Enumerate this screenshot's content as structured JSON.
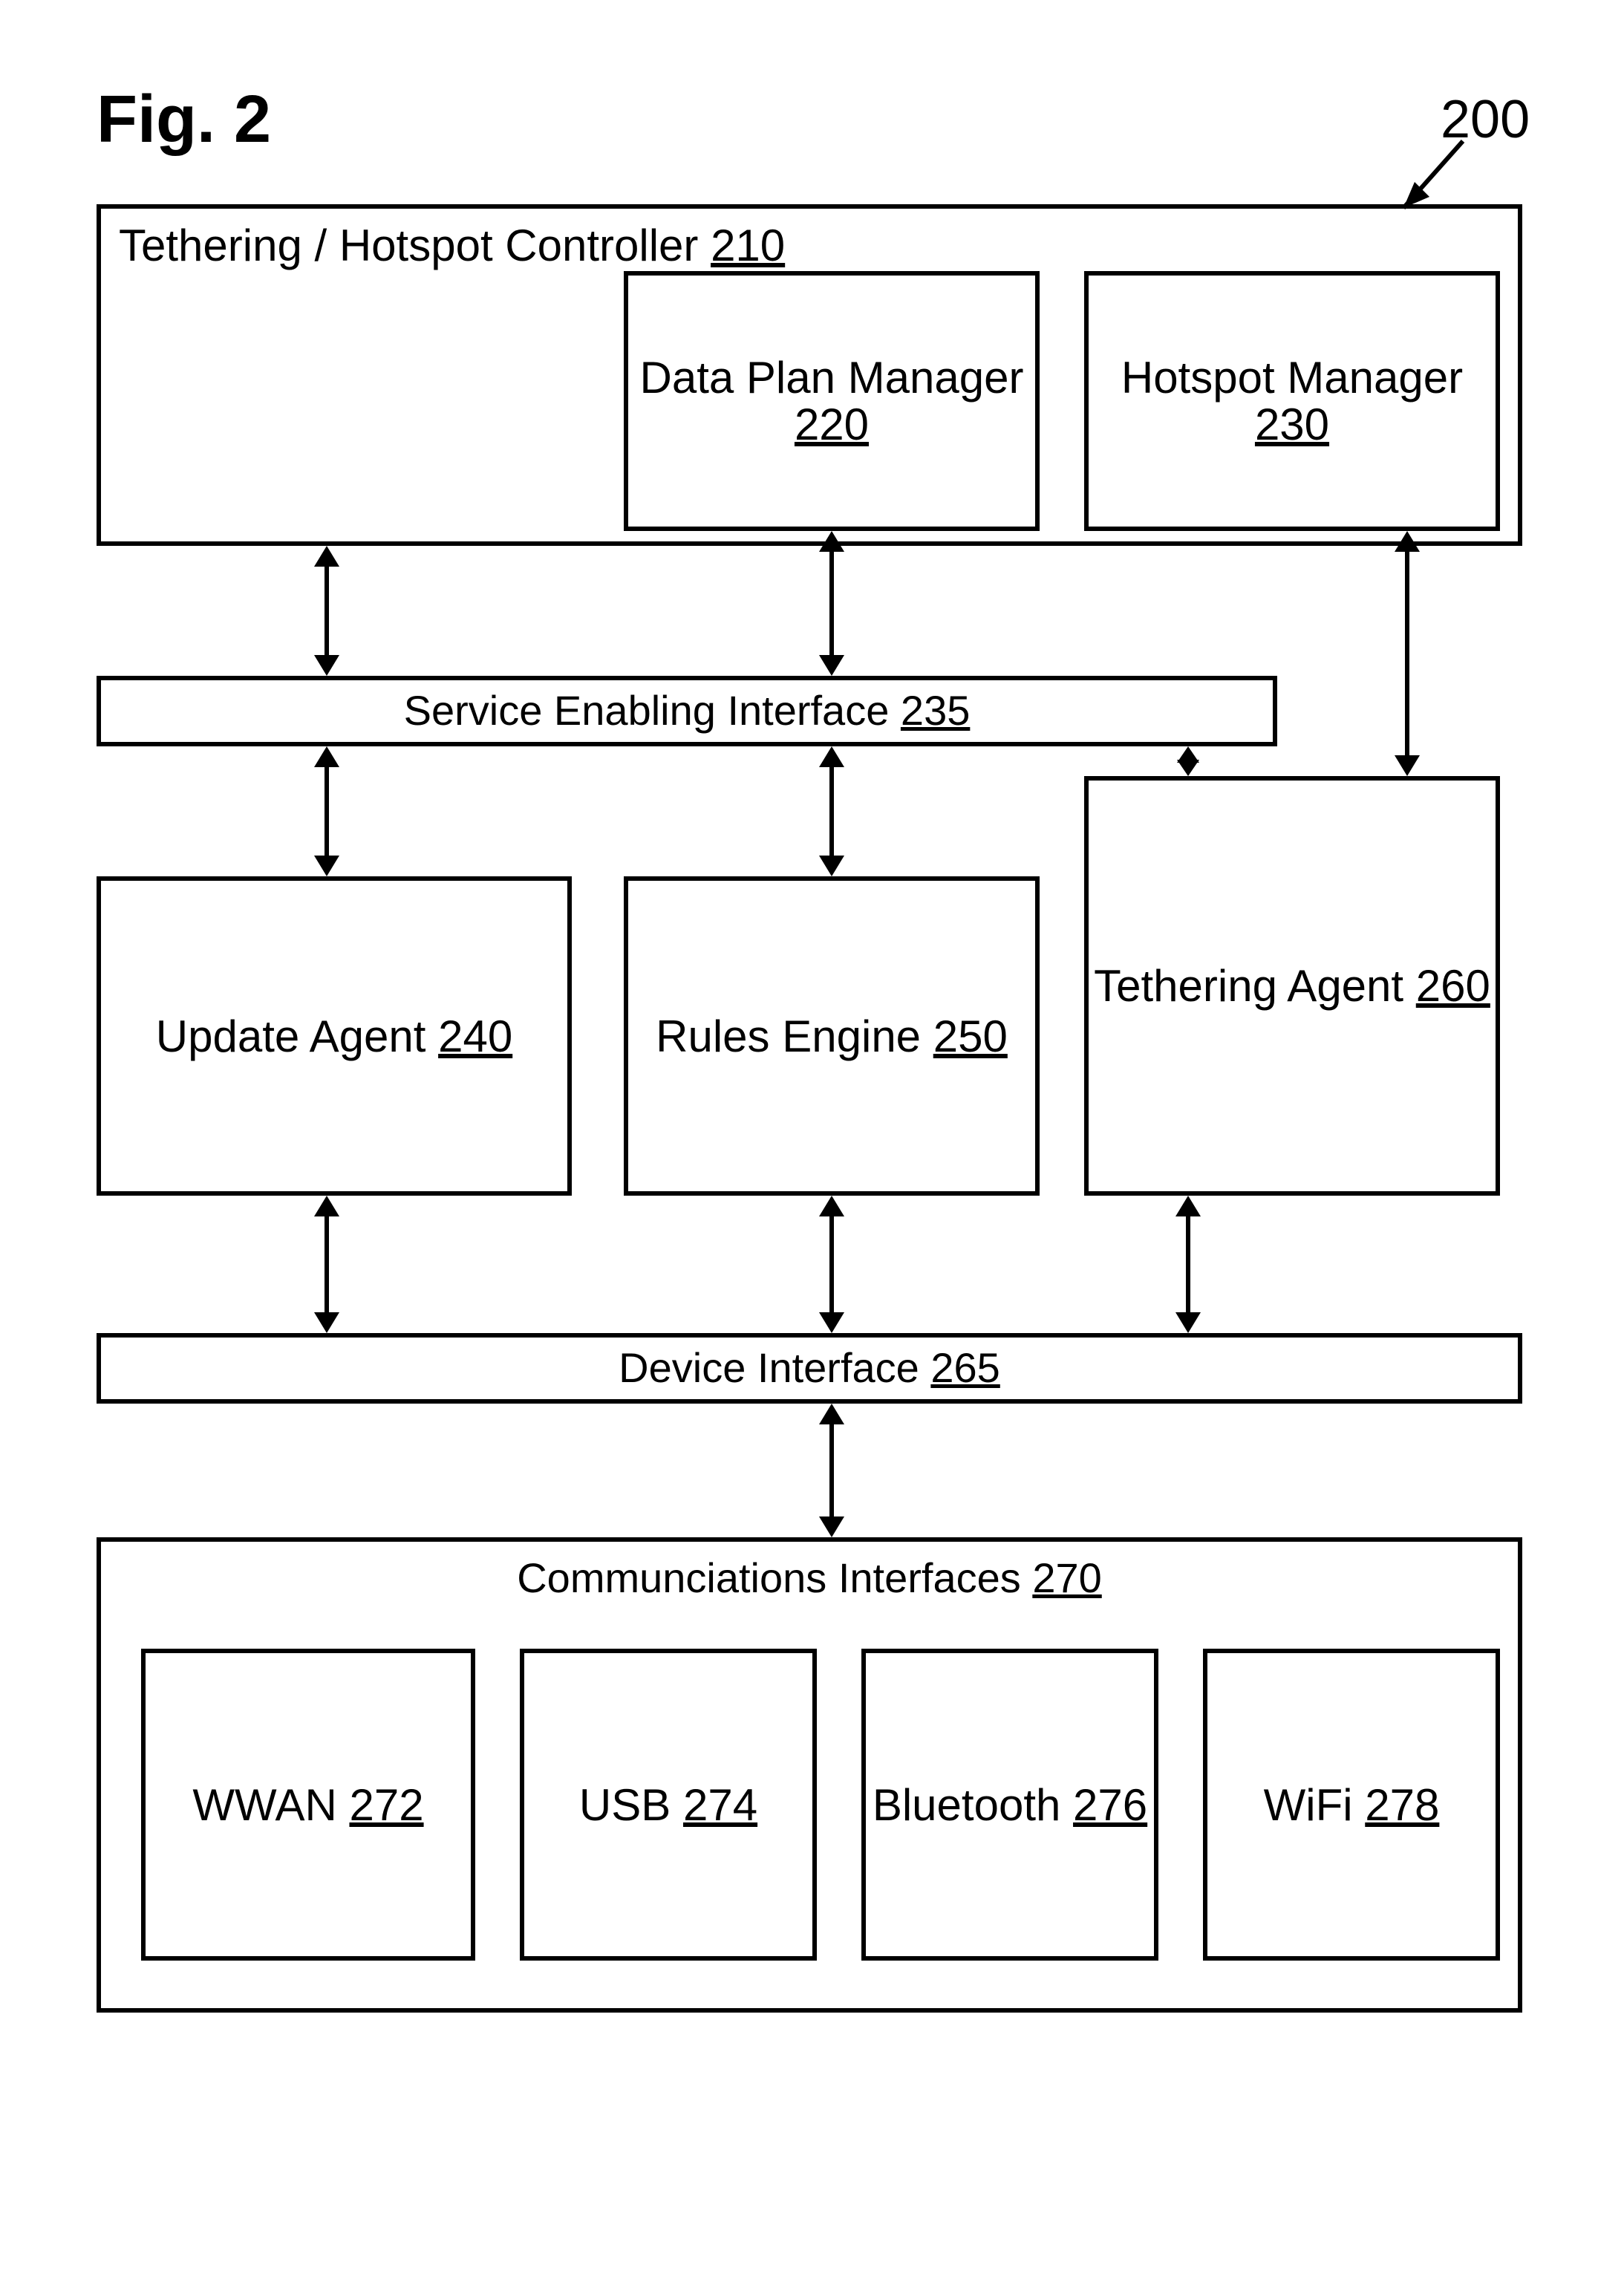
{
  "figure": {
    "title": "Fig. 2",
    "ref": "200"
  },
  "boxes": {
    "controller": {
      "label": "Tethering / Hotspot Controller",
      "num": "210"
    },
    "dataplan": {
      "label": "Data Plan Manager",
      "num": "220"
    },
    "hotspot": {
      "label": "Hotspot Manager",
      "num": "230"
    },
    "svcif": {
      "label": "Service Enabling Interface",
      "num": "235"
    },
    "update": {
      "label": "Update Agent",
      "num": "240"
    },
    "rules": {
      "label": "Rules Engine",
      "num": "250"
    },
    "tether": {
      "label": "Tethering Agent",
      "num": "260"
    },
    "devif": {
      "label": "Device Interface",
      "num": "265"
    },
    "comm": {
      "label": "Communciations Interfaces",
      "num": "270"
    },
    "wwan": {
      "label": "WWAN",
      "num": "272"
    },
    "usb": {
      "label": "USB",
      "num": "274"
    },
    "bt": {
      "label": "Bluetooth",
      "num": "276"
    },
    "wifi": {
      "label": "WiFi",
      "num": "278"
    }
  }
}
